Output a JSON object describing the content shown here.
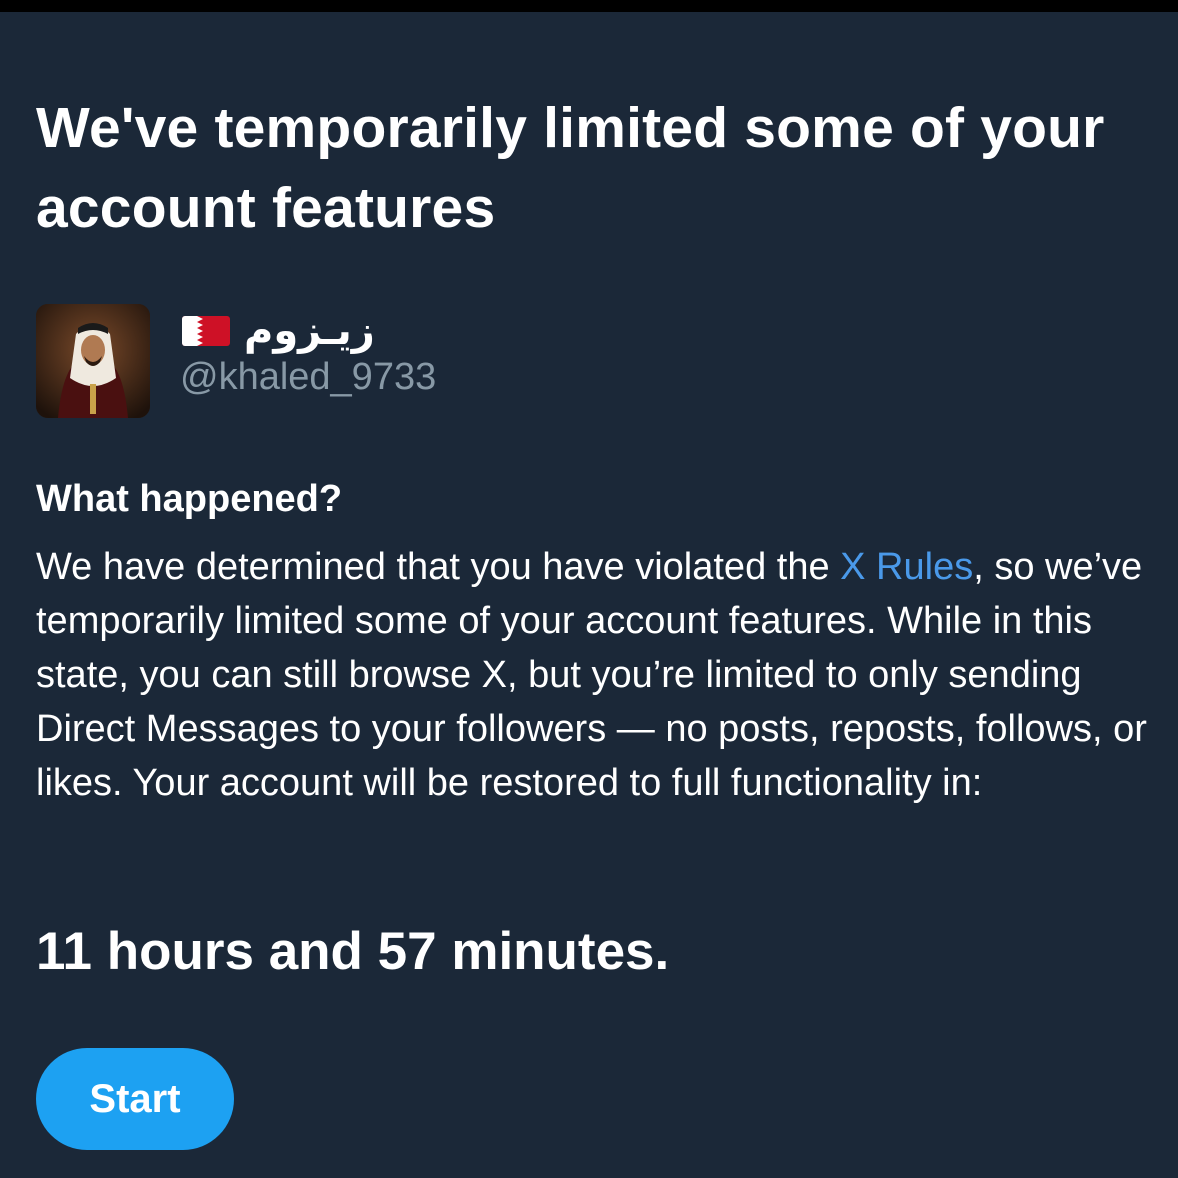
{
  "notice": {
    "title": "We've temporarily limited some of your account features"
  },
  "account": {
    "flag_icon": "bahrain-flag-icon",
    "display_name": "زيـزوم",
    "handle": "@khaled_9733"
  },
  "explanation": {
    "heading": "What happened?",
    "text_before_link": "We have determined that you have violated the ",
    "link_label": "X Rules",
    "text_after_link": ", so we’ve temporarily limited some of your account features. While in this state, you can still browse X, but you’re limited to only sending Direct Messages to your followers — no posts, reposts, follows, or likes. Your account will be restored to full functionality in:"
  },
  "countdown": "11 hours and 57 minutes.",
  "actions": {
    "start_label": "Start"
  },
  "colors": {
    "background": "#1b2838",
    "accent_button": "#1da1f2",
    "link": "#4a99e9",
    "secondary_text": "#8899a6"
  }
}
